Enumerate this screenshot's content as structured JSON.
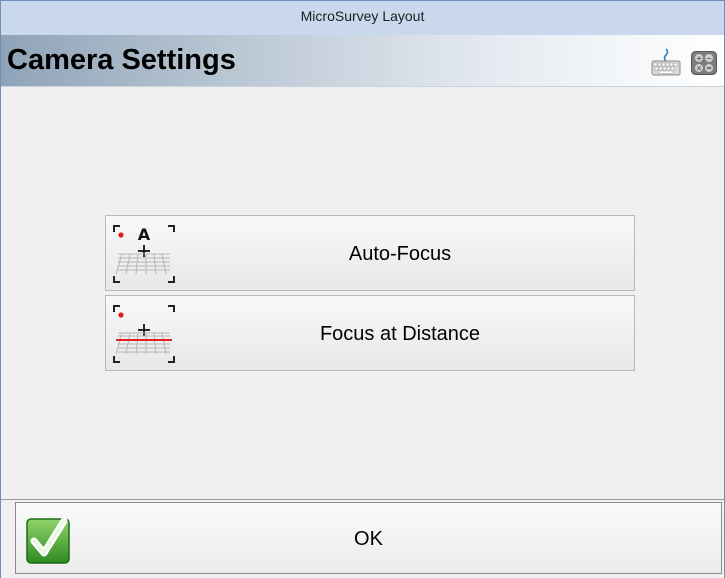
{
  "window": {
    "title": "MicroSurvey Layout"
  },
  "header": {
    "title": "Camera Settings"
  },
  "buttons": [
    {
      "label": "Auto-Focus",
      "icon": "autofocus-icon"
    },
    {
      "label": "Focus at Distance",
      "icon": "focus-distance-icon"
    }
  ],
  "footer": {
    "ok_label": "OK",
    "icon": "check-icon"
  },
  "colors": {
    "title_bar": "#c9d8ec",
    "accent_red": "#e02020",
    "check_green": "#3a9a2a"
  }
}
